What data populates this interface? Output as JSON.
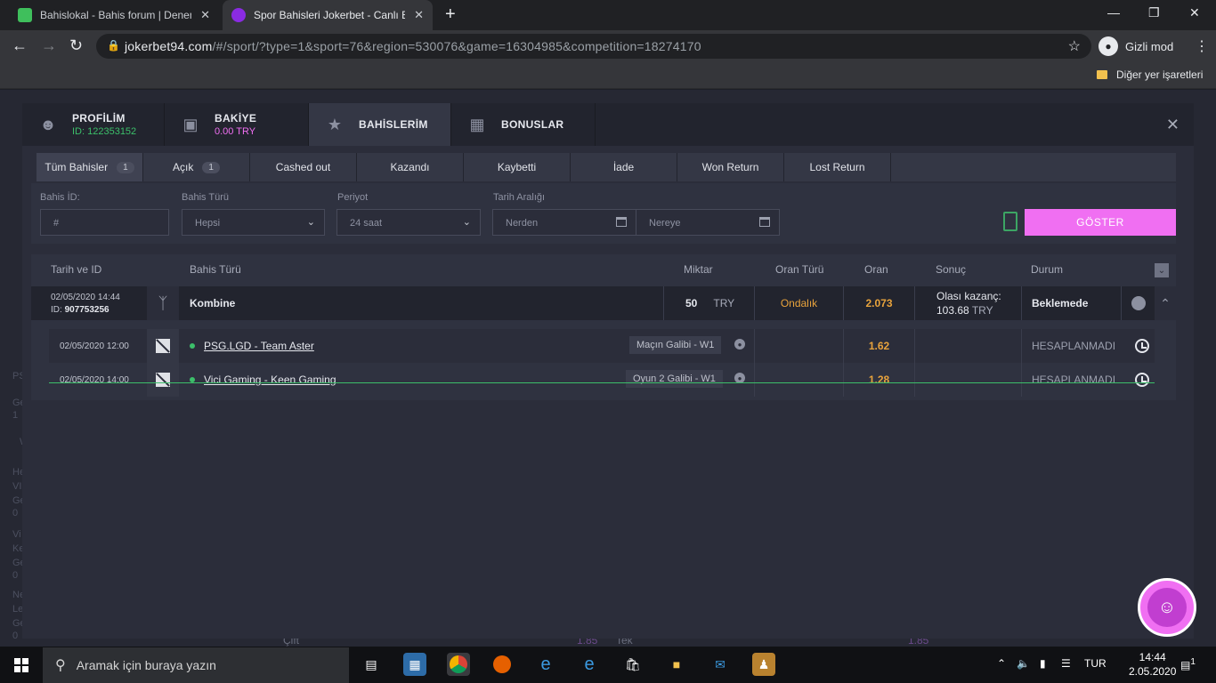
{
  "browser": {
    "tabs": [
      {
        "title": "Bahislokal - Bahis forum | Denem",
        "close": "✕",
        "favicon_color": "#3fbf5c"
      },
      {
        "title": "Spor Bahisleri Jokerbet - Canlı Ba",
        "close": "✕",
        "favicon_color": "#8a2be2"
      }
    ],
    "new_tab": "+",
    "url_host": "jokerbet94.com",
    "url_path": "/#/sport/?type=1&sport=76&region=530076&game=16304985&competition=18274170",
    "incognito_label": "Gizli mod",
    "bookmarks_label": "Diğer yer işaretleri"
  },
  "modal": {
    "tabs": [
      {
        "label": "PROFİLİM",
        "sub": "ID: 122353152",
        "sub_color": "#3cbf6a",
        "icon": "user-icon"
      },
      {
        "label": "BAKİYE",
        "sub": "0.00 TRY",
        "sub_color": "#f06ff2",
        "icon": "wallet-icon"
      },
      {
        "label": "BAHİSLERİM",
        "sub": "",
        "icon": "trophy-icon"
      },
      {
        "label": "BONUSLAR",
        "sub": "",
        "icon": "gift-icon"
      }
    ],
    "close": "✕",
    "subtabs": [
      {
        "label": "Tüm Bahisler",
        "count": "1"
      },
      {
        "label": "Açık",
        "count": "1"
      },
      {
        "label": "Cashed out"
      },
      {
        "label": "Kazandı"
      },
      {
        "label": "Kaybetti"
      },
      {
        "label": "İade"
      },
      {
        "label": "Won Return"
      },
      {
        "label": "Lost Return"
      }
    ],
    "filters": {
      "bet_id_label": "Bahis İD:",
      "bet_id_placeholder": "#",
      "bet_type_label": "Bahis Türü",
      "bet_type_value": "Hepsi",
      "period_label": "Periyot",
      "period_value": "24 saat",
      "date_label": "Tarih Aralığı",
      "from_placeholder": "Nerden",
      "to_placeholder": "Nereye",
      "show_button": "GÖSTER"
    },
    "columns": {
      "date_id": "Tarih ve ID",
      "bet_type": "Bahis Türü",
      "amount": "Miktar",
      "odds_type": "Oran Türü",
      "odds": "Oran",
      "result": "Sonuç",
      "status": "Durum"
    },
    "bet": {
      "date": "02/05/2020 14:44",
      "id_label": "ID:",
      "id": "907753256",
      "type": "Kombine",
      "amount": "50",
      "currency": "TRY",
      "odds_type": "Ondalık",
      "odds": "2.073",
      "possible_win_label": "Olası kazanç:",
      "possible_win": "103.68",
      "possible_win_currency": "TRY",
      "status": "Beklemede"
    },
    "selections": [
      {
        "date": "02/05/2020 12:00",
        "event": "PSG.LGD - Team Aster",
        "market": "Maçın Galibi - W1",
        "odds": "1.62",
        "status": "HESAPLANMADI"
      },
      {
        "date": "02/05/2020 14:00",
        "event": "Vici Gaming - Keen Gaming",
        "market": "Oyun 2 Galibi - W1",
        "odds": "1.28",
        "status": "HESAPLANMADI"
      }
    ]
  },
  "background": {
    "left_labels": [
      "PS",
      "Ge",
      "1",
      "W",
      "He",
      "VI",
      "Ge",
      "0",
      "Vi",
      "Ke",
      "Ge",
      "0",
      "Ne",
      "Le",
      "Ge",
      "0"
    ],
    "bottom_left": "Çift",
    "bottom_odds1": "1.85",
    "bottom_mid": "Tek",
    "bottom_odds2": "1.85"
  },
  "taskbar": {
    "search_placeholder": "Aramak için buraya yazın",
    "lang": "TUR",
    "time": "14:44",
    "date": "2.05.2020",
    "notif_count": "1"
  },
  "colors": {
    "accent_pink": "#f06ff2",
    "odds_orange": "#e8a33c",
    "green": "#3cbf6a"
  }
}
